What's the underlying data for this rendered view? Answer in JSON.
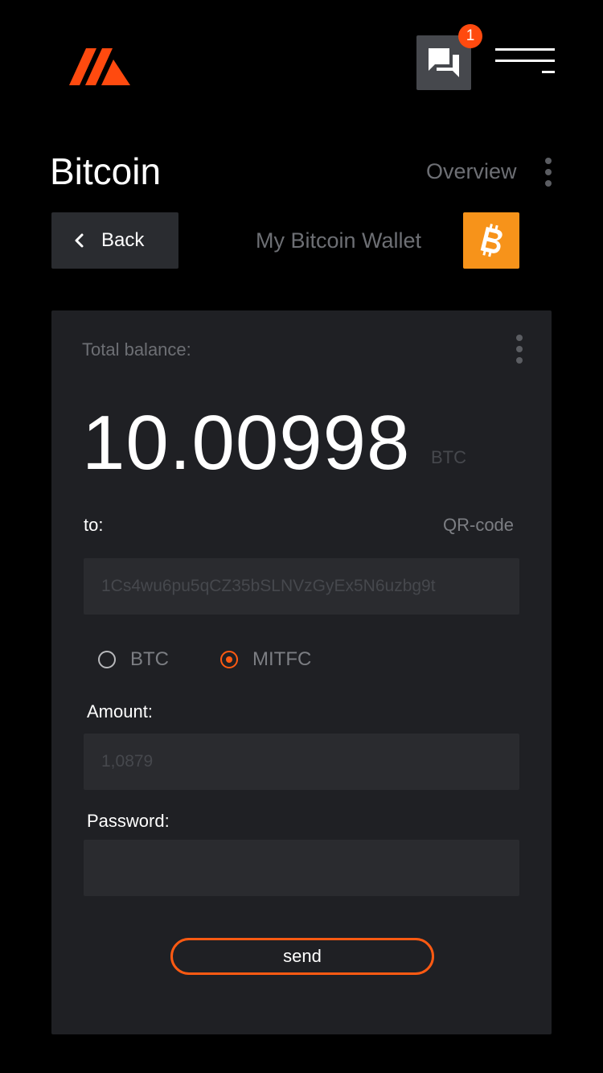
{
  "header": {
    "logo_icon": "brand-logo",
    "chat_icon": "chat-icon",
    "notification_count": "1",
    "menu_icon": "menu-icon"
  },
  "page": {
    "title": "Bitcoin",
    "overview_label": "Overview",
    "back_label": "Back",
    "wallet_name": "My Bitcoin Wallet",
    "wallet_icon": "bitcoin-icon"
  },
  "card": {
    "total_label": "Total balance:",
    "balance_value": "10.00998",
    "balance_unit": "BTC",
    "to_label": "to:",
    "qr_label": "QR-code",
    "address_placeholder": "1Cs4wu6pu5qCZ35bSLNVzGyEx5N6uzbg9t",
    "currency_options": [
      {
        "label": "BTC",
        "selected": false
      },
      {
        "label": "MITFC",
        "selected": true
      }
    ],
    "amount_label": "Amount:",
    "amount_placeholder": "1,0879",
    "password_label": "Password:",
    "password_value": "",
    "send_label": "send"
  },
  "colors": {
    "accent": "#ff5a12",
    "bitcoin": "#f7931a",
    "card_bg": "#1f2024",
    "page_bg": "#000000"
  }
}
